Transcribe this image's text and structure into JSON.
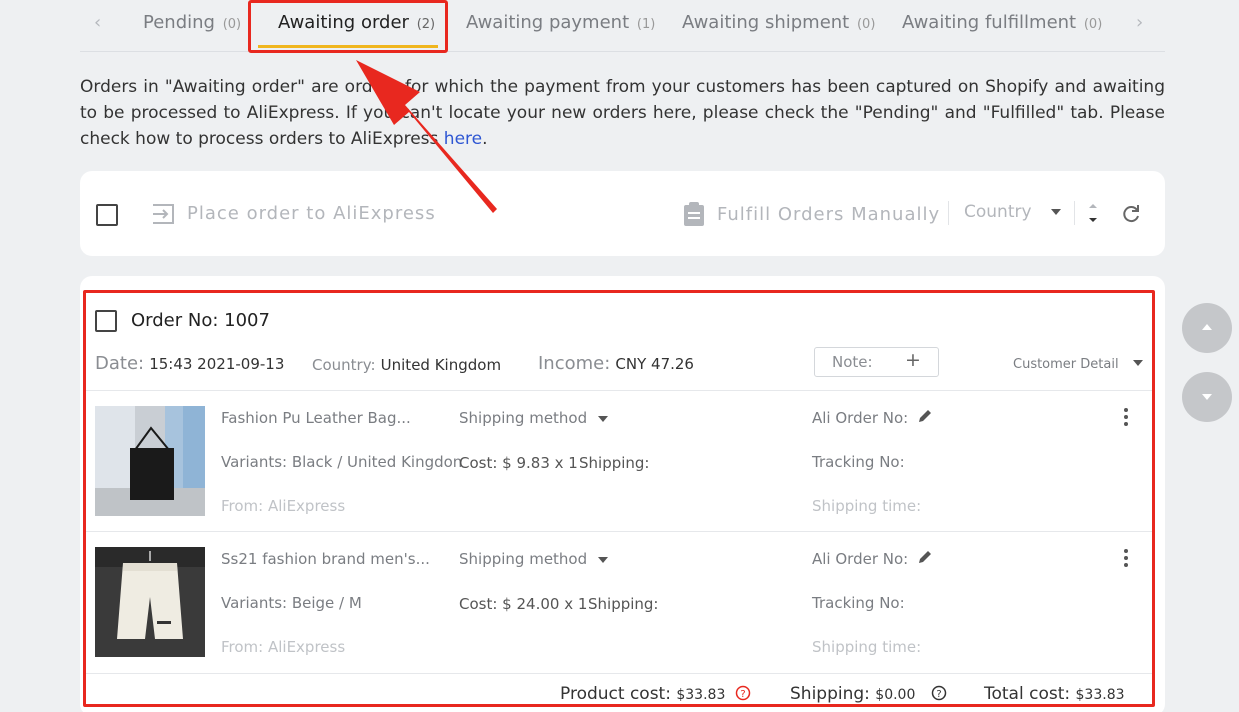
{
  "tabs": {
    "items": [
      {
        "label": "Pending",
        "count": "(0)"
      },
      {
        "label": "Awaiting order",
        "count": "(2)"
      },
      {
        "label": "Awaiting payment",
        "count": "(1)"
      },
      {
        "label": "Awaiting shipment",
        "count": "(0)"
      },
      {
        "label": "Awaiting fulfillment",
        "count": "(0)"
      }
    ],
    "prev_icon": "chevron-left-icon",
    "next_icon": "chevron-right-icon"
  },
  "description": {
    "text": "Orders in \"Awaiting order\" are orders for which the payment from your customers has been captured on Shopify and awaiting to be processed to AliExpress. If you can't locate your new orders here, please check the \"Pending\" and \"Fulfilled\" tab. Please check how to process orders to AliExpress ",
    "link": "here",
    "end": "."
  },
  "actionbar": {
    "place_order": "Place order to AliExpress",
    "fulfill_manually": "Fulfill Orders Manually",
    "country": "Country"
  },
  "order": {
    "title": "Order No: 1007",
    "date_label": "Date:",
    "date_value": "15:43 2021-09-13",
    "country_label": "Country:",
    "country_value": "United Kingdom",
    "income_label": "Income:",
    "income_value": "CNY 47.26",
    "note_label": "Note:",
    "note_add": "+",
    "customer_detail": "Customer Detail",
    "items": [
      {
        "name": "Fashion Pu Leather Bag...",
        "variants": "Variants: Black / United Kingdon",
        "from": "From: AliExpress",
        "shipping_method": "Shipping method",
        "cost": "Cost: $ 9.83 x 1",
        "shipping": "Shipping:",
        "ali_order": "Ali Order No:",
        "tracking": "Tracking No:",
        "shipping_time": "Shipping time:"
      },
      {
        "name": "Ss21 fashion brand men's...",
        "variants": "Variants: Beige / M",
        "from": "From: AliExpress",
        "shipping_method": "Shipping method",
        "cost": "Cost: $ 24.00 x 1",
        "shipping": "Shipping:",
        "ali_order": "Ali Order No:",
        "tracking": "Tracking No:",
        "shipping_time": "Shipping time:"
      }
    ],
    "totals": {
      "product_cost_label": "Product cost:",
      "product_cost_value": "$33.83",
      "shipping_label": "Shipping:",
      "shipping_value": "$0.00",
      "total_label": "Total cost:",
      "total_value": "$33.83"
    }
  },
  "colors": {
    "highlight": "#e8281f",
    "tab_accent": "#f0b61e",
    "link": "#2f57d3",
    "help_red": "#e8281f"
  }
}
